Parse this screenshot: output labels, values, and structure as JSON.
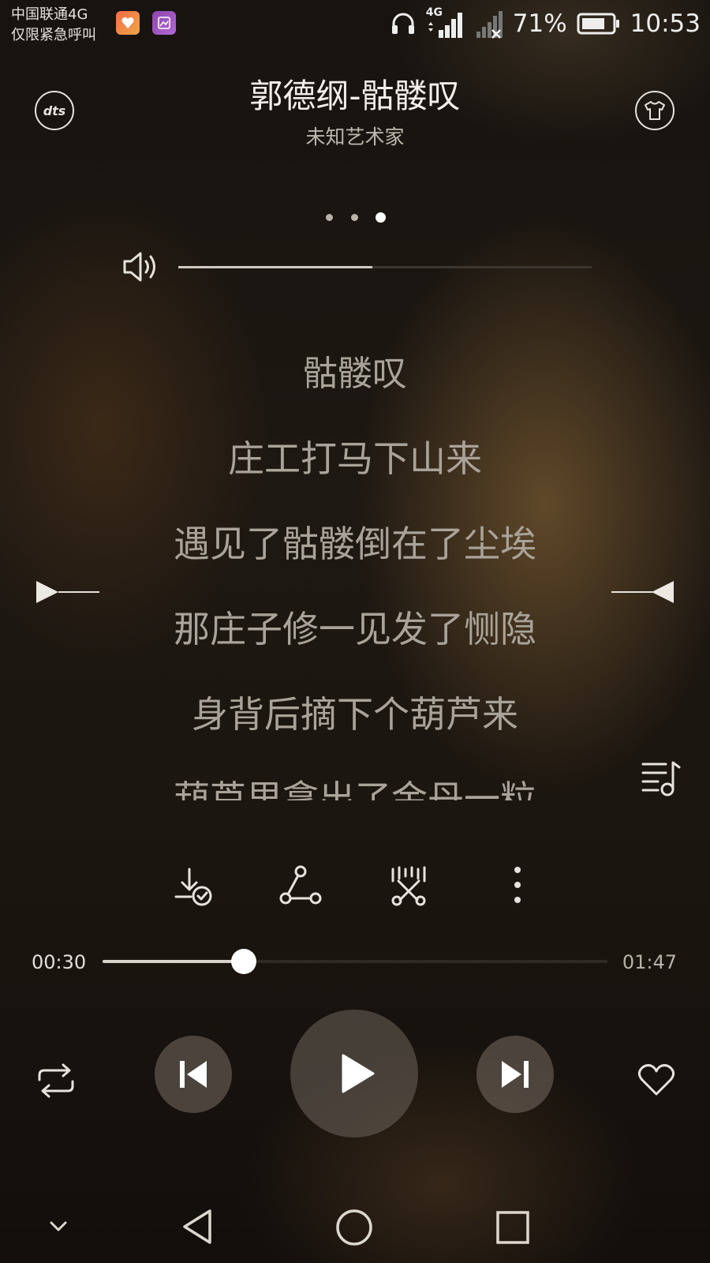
{
  "status_bar": {
    "carrier_line1": "中国联通4G",
    "carrier_line2": "仅限紧急呼叫",
    "network_label": "4G",
    "battery_percent": "71%",
    "time": "10:53",
    "icons": [
      "health-app-icon",
      "gallery-app-icon",
      "headphones-icon",
      "signal-icon",
      "no-signal-icon",
      "battery-icon"
    ]
  },
  "header": {
    "title": "郭德纲-骷髅叹",
    "artist": "未知艺术家",
    "dts_label": "dts",
    "left_icon": "dts-icon",
    "right_icon": "tshirt-skin-icon"
  },
  "pager": {
    "count": 3,
    "active_index": 2
  },
  "volume": {
    "level": 0.47,
    "icon": "speaker-icon"
  },
  "lyrics": [
    "骷髅叹",
    "庄工打马下山来",
    "遇见了骷髅倒在了尘埃",
    "那庄子修一见发了恻隐",
    "身背后摘下个葫芦来",
    "葫芦里拿出了金丹一粒"
  ],
  "action_icons": [
    "download-done-icon",
    "share-icon",
    "cut-ringtone-icon",
    "more-icon",
    "playlist-icon"
  ],
  "progress": {
    "current": "00:30",
    "total": "01:47",
    "fraction": 0.28
  },
  "controls": [
    "repeat-icon",
    "previous-icon",
    "play-icon",
    "next-icon",
    "heart-icon"
  ],
  "nav_bar": [
    "collapse-chevron-icon",
    "back-icon",
    "home-icon",
    "recents-icon"
  ],
  "colors": {
    "accent": "#ffffff",
    "lyric": "#a9a39a",
    "background": "#1b150f"
  }
}
